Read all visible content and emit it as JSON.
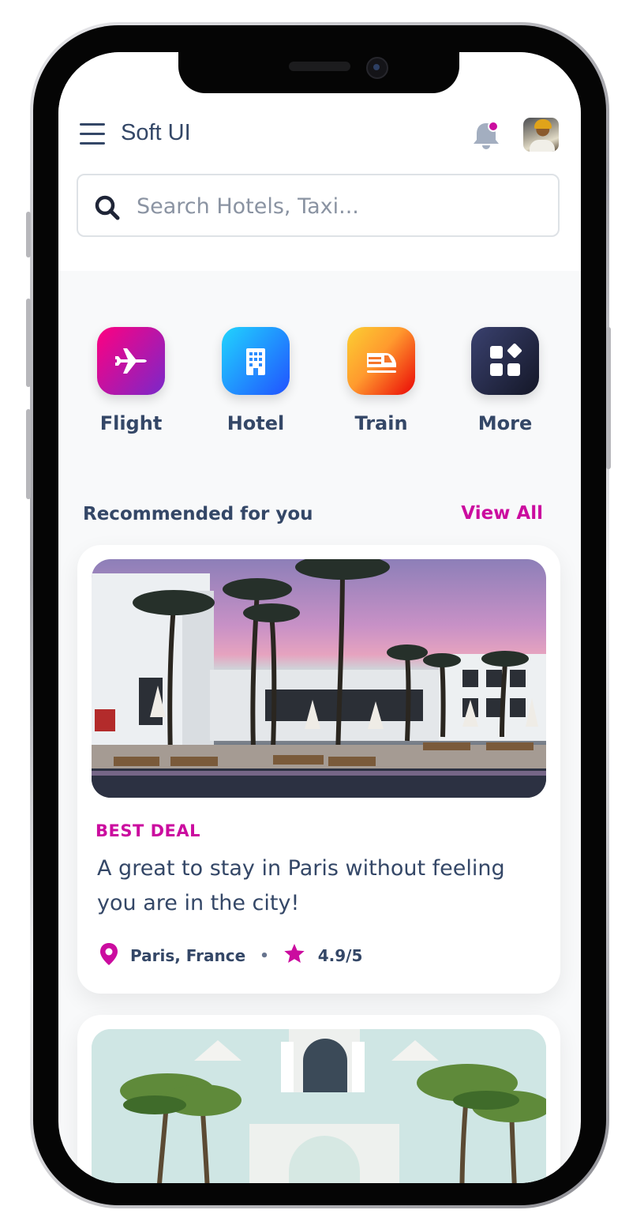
{
  "header": {
    "app_title": "Soft UI",
    "search_placeholder": "Search Hotels, Taxi..."
  },
  "categories": [
    {
      "label": "Flight",
      "icon": "airplane-icon",
      "gradient": [
        "#ee0979",
        "#8e2de2"
      ]
    },
    {
      "label": "Hotel",
      "icon": "building-icon",
      "gradient": [
        "#21d4fd",
        "#2152ff"
      ]
    },
    {
      "label": "Train",
      "icon": "train-icon",
      "gradient": [
        "#fbcf33",
        "#ea0606"
      ]
    },
    {
      "label": "More",
      "icon": "apps-icon",
      "gradient": [
        "#3a416f",
        "#141727"
      ]
    }
  ],
  "recommended": {
    "title": "Recommended for you",
    "view_all": "View All",
    "cards": [
      {
        "badge": "BEST DEAL",
        "title": "A great to stay in Paris without feeling you are in the city!",
        "location": "Paris, France",
        "rating": "4.9/5"
      }
    ]
  },
  "colors": {
    "primary": "#cb0c9f",
    "text": "#344767",
    "muted": "#8a93a2"
  }
}
